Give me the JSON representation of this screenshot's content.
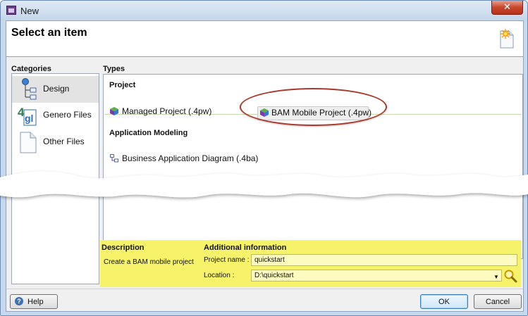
{
  "window": {
    "title": "New",
    "close_glyph": "✕"
  },
  "header": {
    "title": "Select an item",
    "icon": "new-item-sparkle-icon"
  },
  "categories": {
    "label": "Categories",
    "items": [
      {
        "label": "Design",
        "icon": "design-tree-icon",
        "selected": true
      },
      {
        "label": "Genero Files",
        "icon": "genero-4gl-icon",
        "selected": false
      },
      {
        "label": "Other Files",
        "icon": "blank-file-icon",
        "selected": false
      }
    ]
  },
  "types": {
    "label": "Types",
    "sections": [
      {
        "header": "Project",
        "items": [
          {
            "label": "Managed Project (.4pw)",
            "icon": "project-cube-icon",
            "selected": false
          },
          {
            "label": "BAM Mobile Project (.4pw)",
            "icon": "project-cube-icon",
            "selected": true
          }
        ]
      },
      {
        "header": "Application Modeling",
        "items": [
          {
            "label": "Business Application Diagram (.4ba)",
            "icon": "diagram-icon",
            "selected": false
          }
        ]
      }
    ]
  },
  "description": {
    "label": "Description",
    "text": "Create a BAM mobile project"
  },
  "additional": {
    "label": "Additional information",
    "project_name_label": "Project name :",
    "project_name_value": "quickstart",
    "location_label": "Location :",
    "location_value": "D:\\quickstart"
  },
  "buttons": {
    "help": "Help",
    "ok": "OK",
    "cancel": "Cancel"
  },
  "colors": {
    "highlight_panel": "#f6f36a",
    "annotation_ellipse": "#a8392d"
  }
}
